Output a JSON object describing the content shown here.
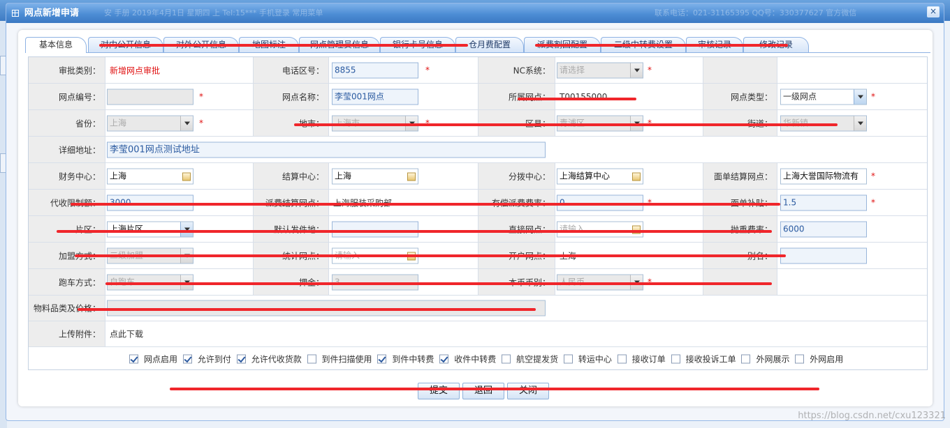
{
  "dialog": {
    "title": "网点新增申请",
    "title_noise_left": "安 手册 2019年4月1日 星期四 上  Tel:15*** 手机登录 常用菜单",
    "title_noise_right": "联系电话：021-31165395  QQ号：330377627  官方微信",
    "close_label": "×"
  },
  "tabs": [
    {
      "label": "基本信息",
      "active": true
    },
    {
      "label": "对内公开信息"
    },
    {
      "label": "对外公开信息"
    },
    {
      "label": "地图标注"
    },
    {
      "label": "网点管理员信息"
    },
    {
      "label": "银行卡号信息"
    },
    {
      "label": "仓月费配置"
    },
    {
      "label": "派费割回配置"
    },
    {
      "label": "二级中转费设置"
    },
    {
      "label": "审核记录"
    },
    {
      "label": "修改记录"
    }
  ],
  "form": {
    "row1": {
      "audit_type_label": "审批类别：",
      "audit_type_value": "新增网点审批",
      "area_code_label": "电话区号：",
      "area_code_value": "8855",
      "nc_label": "NC系统：",
      "nc_placeholder": "请选择",
      "req": "*"
    },
    "row2": {
      "site_code_label": "网点编号：",
      "site_code_value": "",
      "site_name_label": "网点名称：",
      "site_name_value": "李莹001网点",
      "parent_label": "所属网点：",
      "parent_value": "T00155000",
      "site_type_label": "网点类型：",
      "site_type_value": "一级网点"
    },
    "row3": {
      "province_label": "省份：",
      "province_value": "上海",
      "city_label": "地市：",
      "city_value": "上海市",
      "district_label": "区县：",
      "district_value": "青浦区",
      "street_label": "街道：",
      "street_value": "华新镇"
    },
    "row4": {
      "address_label": "详细地址：",
      "address_value": "李莹001网点测试地址"
    },
    "row5": {
      "finance_label": "财务中心：",
      "finance_value": "上海",
      "settle_label": "结算中心：",
      "settle_value": "上海",
      "branch_label": "分拨中心：",
      "branch_value": "上海结算中心",
      "face_label": "面单结算网点：",
      "face_value": "上海大誉国际物流有"
    },
    "row6": {
      "cod_label": "代收限制额：",
      "cod_value": "3000",
      "dispatch_label": "派费结算网点：",
      "dispatch_value": "上海服装采购部",
      "paid_label": "有偿派费费率：",
      "paid_value": "0",
      "subsidy_label": "面单补贴：",
      "subsidy_value": "1.5"
    },
    "row7": {
      "region_label": "片区：",
      "region_value": "上海片区",
      "default_send_label": "默认发件地：",
      "default_send_value": "",
      "superior_label": "直接网点：",
      "superior_placeholder": "请输入",
      "ratio_label": "抛重费率：",
      "ratio_value": "6000"
    },
    "row8": {
      "join_label": "加盟方式：",
      "join_value": "二级加盟",
      "stat_label": "统计网点：",
      "stat_placeholder": "请输入",
      "open_label": "开户网点：",
      "open_value": "上海",
      "alias_label": "别名：",
      "alias_value": ""
    },
    "row9": {
      "run_label": "跑车方式：",
      "run_value": "自跑车",
      "deposit_label": "押金：",
      "deposit_value": "3",
      "currency_label": "本币币别：",
      "currency_value": "人民币"
    },
    "row10": {
      "material_label": "物料品类及价格：",
      "material_value": ""
    },
    "row11": {
      "upload_label": "上传附件：",
      "upload_value": "点此下载"
    },
    "checks": [
      {
        "label": "网点启用",
        "checked": true
      },
      {
        "label": "允许到付",
        "checked": true
      },
      {
        "label": "允许代收货款",
        "checked": true
      },
      {
        "label": "到件扫描使用",
        "checked": false
      },
      {
        "label": "到件中转费",
        "checked": true
      },
      {
        "label": "收件中转费",
        "checked": true
      },
      {
        "label": "航空提发货",
        "checked": false
      },
      {
        "label": "转运中心",
        "checked": false
      },
      {
        "label": "接收订单",
        "checked": false
      },
      {
        "label": "接收投诉工单",
        "checked": false
      },
      {
        "label": "外网展示",
        "checked": false
      },
      {
        "label": "外网启用",
        "checked": false
      }
    ]
  },
  "buttons": {
    "submit": "提交",
    "back": "退回",
    "close": "关闭"
  },
  "watermark": "https://blog.csdn.net/cxu123321",
  "colors": {
    "accent": "#4d8dd5",
    "strike": "#f0262b",
    "required": "#e01010"
  }
}
